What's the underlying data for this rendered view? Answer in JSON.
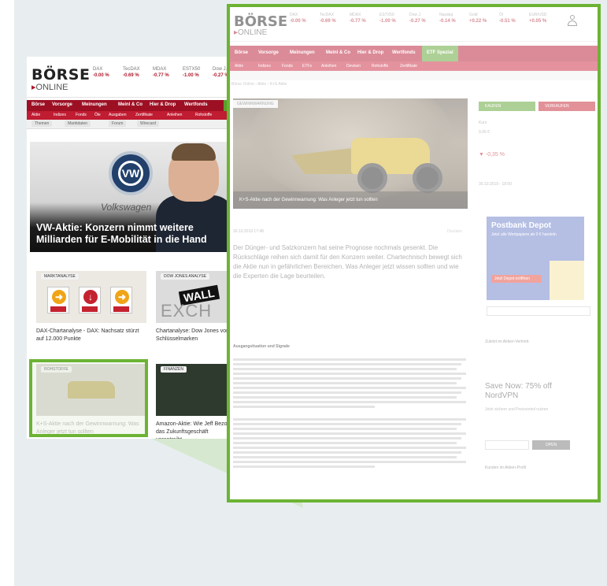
{
  "home": {
    "logo_top": "BÖRSE",
    "logo_bottom": "ONLINE",
    "indices": [
      {
        "name": "DAX",
        "value": "-0.00 %"
      },
      {
        "name": "TecDAX",
        "value": "-0.69 %"
      },
      {
        "name": "MDAX",
        "value": "-0.77 %"
      },
      {
        "name": "ESTX50",
        "value": "-1.00 %"
      },
      {
        "name": "Dow J.",
        "value": "-0.27 %"
      }
    ],
    "nav": [
      "Börse",
      "Vorsorge",
      "Meinungen",
      "Meinl & Co",
      "Hier & Drop",
      "Wertfonds"
    ],
    "nav2": [
      "Aktie",
      "Indizes",
      "Fonds",
      "Öle",
      "Ausgaben",
      "Zertifikate",
      "Anleihen",
      "Rohstoffe"
    ],
    "nav3": [
      "Themen",
      "Marktdaten",
      "Forum",
      "Wirecard"
    ],
    "hero_brand": "Volkswagen",
    "hero_logo": "VW",
    "hero_title": "VW-Aktie: Konzern nimmt weitere Milliarden für E-Mobilität in die Hand",
    "thumb_labels": [
      "MARKTANALYSE",
      "DOW JONES ANALYSE",
      "ROHSTOFFE",
      "FINANZEN"
    ],
    "thumb_words": [
      "WALL",
      "EXCH"
    ],
    "captions": [
      "DAX-Chartanalyse - DAX: Nachsatz stürzt auf 12.000 Punkte",
      "Chartanalyse: Dow Jones vor Schlüsselmarken",
      "K+S-Aktie nach der Gewinnwarnung: Was Anleger jetzt tun sollten",
      "Amazon-Aktie: Wie Jeff Bezos das Zukunftsgeschäft vorantreibt"
    ]
  },
  "article": {
    "logo_top": "BÖRSE",
    "logo_bottom": "ONLINE",
    "indices": [
      "DAX",
      "TecDAX",
      "MDAX",
      "ESTX50",
      "Dow J.",
      "Nasdaq",
      "Gold",
      "Öl",
      "EUR/USD",
      "$"
    ],
    "nav": [
      "Börse",
      "Vorsorge",
      "Meinungen",
      "Meinl & Co",
      "Hier & Drop",
      "Wertfonds"
    ],
    "etf_label": "ETF Spezial",
    "nav2": [
      "Aktie",
      "Indizes",
      "Fonds",
      "ETFs",
      "Anleihen",
      "Devisen",
      "Rohstoffe",
      "Zertifikate"
    ],
    "breadcrumb": "Börse Online › Aktie › K+S Aktie",
    "section_tag": "GEWINNWARNUNG",
    "hero_caption": "K+S-Aktie nach der Gewinnwarnung: Was Anleger jetzt tun sollten",
    "meta": "30.10.2019 17:48",
    "meta_right": "Drucken",
    "lead": "Der Dünger- und Salzkonzern hat seine Prognose nochmals gesenkt. Die Rückschläge reihen sich damit für den Konzern weiter. Chartechnisch bewegt sich die Aktie nun in gefährlichen Bereichen. Was Anleger jetzt wissen sollten und wie die Experten die Lage beurteilen.",
    "subheading": "Ausgangsituation und Signale",
    "side_tab_buy": "KAUFEN",
    "side_tab_sell": "VERKAUFEN",
    "side_price_label": "Kurs",
    "side_price": "9,95 €",
    "side_change": "-0,35 %",
    "side_date": "30.10.2019 - 18:00",
    "ad_title": "Postbank Depot",
    "ad_sub": "Jetzt alle Wertpapiere ab 0 € handeln",
    "ad_button": "Jetzt Depot eröffnen",
    "vpn_title": "Save Now: 75% off NordVPN",
    "vpn_sub": "Jetzt sichern und Preisvorteil nutzen",
    "vpn_button": "OPEN",
    "side_heads": [
      "Zuletzt im Aktien-Vertrieb",
      "Kunden im Aktien-Profil"
    ]
  }
}
